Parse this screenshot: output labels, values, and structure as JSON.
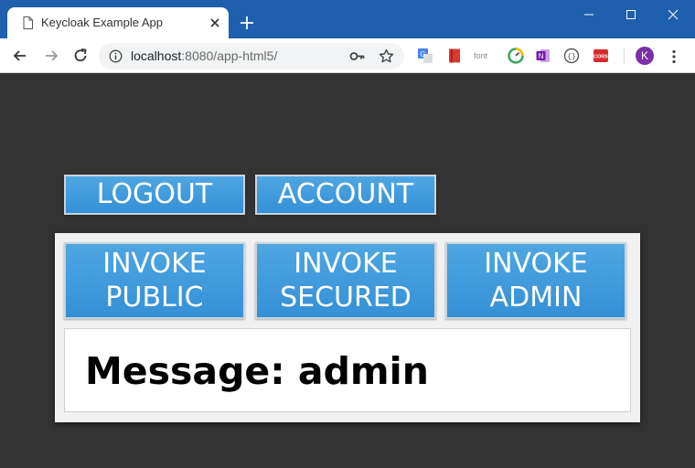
{
  "browser": {
    "tab_title": "Keycloak Example App",
    "url_host": "localhost",
    "url_rest": ":8080/app-html5/",
    "extensions": {
      "font_label": "font",
      "cors_label": "CORS"
    },
    "avatar_letter": "K",
    "colors": {
      "titlebar": "#1e5fae",
      "avatar": "#7b2fa8"
    }
  },
  "app": {
    "top_buttons": {
      "logout": "LOGOUT",
      "account": "ACCOUNT"
    },
    "invoke_buttons": {
      "public": [
        "INVOKE",
        "PUBLIC"
      ],
      "secured": [
        "INVOKE",
        "SECURED"
      ],
      "admin": [
        "INVOKE",
        "ADMIN"
      ]
    },
    "message": "Message: admin",
    "colors": {
      "background": "#333333",
      "button": "#3d9ddc",
      "panel": "#f1f1f1"
    }
  }
}
